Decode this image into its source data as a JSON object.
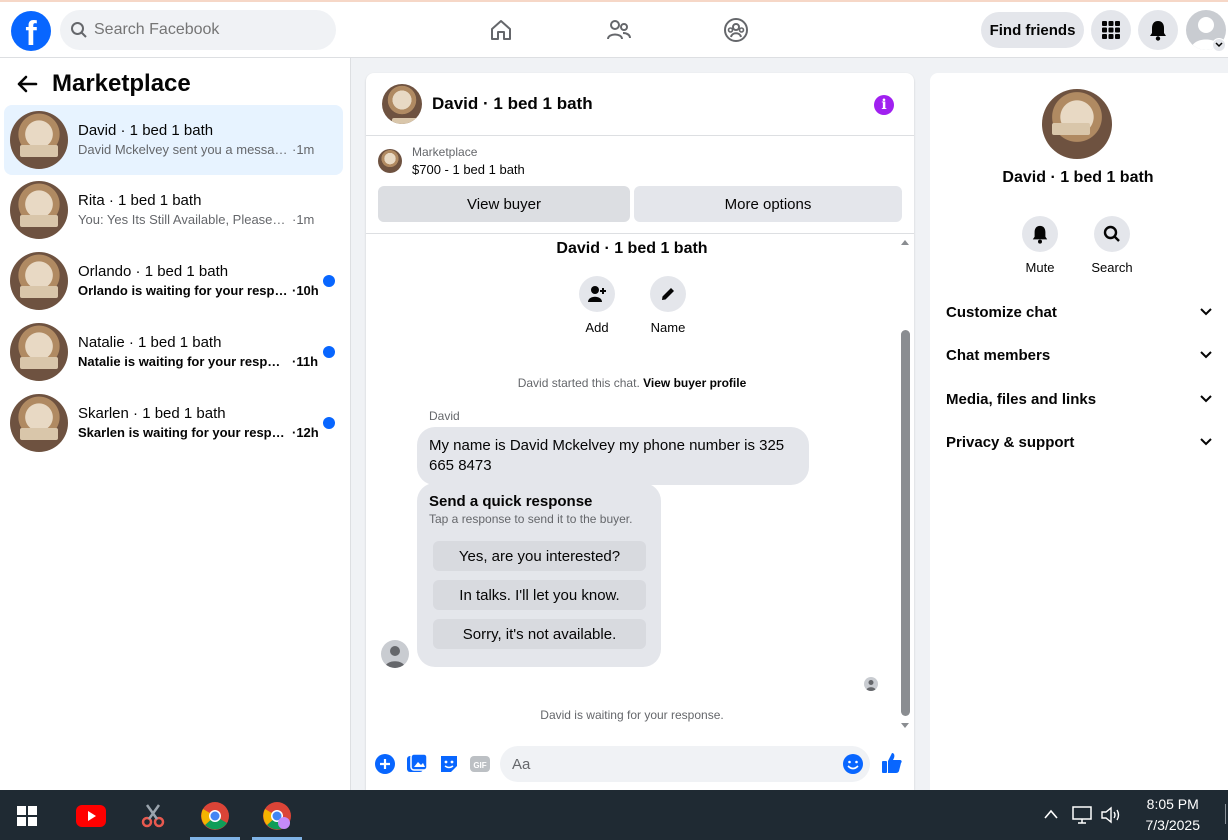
{
  "topbar": {
    "logo_letter": "f",
    "search_placeholder": "Search Facebook",
    "find_friends": "Find friends"
  },
  "left": {
    "title": "Marketplace",
    "conversations": [
      {
        "name": "David · 1 bed 1 bath",
        "message": "David Mckelvey sent you a message ...",
        "time": "·1m",
        "active": true,
        "unread": false
      },
      {
        "name": "Rita · 1 bed 1 bath",
        "message": "You: Yes Its Still Available, Please Sen...",
        "time": "·1m",
        "active": false,
        "unread": false
      },
      {
        "name": "Orlando · 1 bed 1 bath",
        "message": "Orlando is waiting for your respo...",
        "time": "·10h",
        "active": false,
        "unread": true
      },
      {
        "name": "Natalie · 1 bed 1 bath",
        "message": "Natalie is waiting for your respon...",
        "time": "·11h",
        "active": false,
        "unread": true
      },
      {
        "name": "Skarlen · 1 bed 1 bath",
        "message": "Skarlen is waiting for your respo...",
        "time": "·12h",
        "active": false,
        "unread": true
      }
    ]
  },
  "chat": {
    "title": "David · 1 bed 1 bath",
    "info_icon": "i",
    "listing_label": "Marketplace",
    "listing_price": "$700 - 1 bed 1 bath",
    "view_buyer": "View buyer",
    "more_options": "More options",
    "chat_title": "David · 1 bed 1 bath",
    "add_label": "Add",
    "name_label": "Name",
    "started_text": "David started this chat.",
    "view_profile": "View buyer profile",
    "sender": "David",
    "message": "My name is David Mckelvey my phone number is 325 665 8473",
    "quick_title": "Send a quick response",
    "quick_sub": "Tap a response to send it to the buyer.",
    "quick_replies": [
      "Yes, are you interested?",
      "In talks. I'll let you know.",
      "Sorry, it's not available."
    ],
    "waiting": "David is waiting for your response.",
    "composer_placeholder": "Aa"
  },
  "info_panel": {
    "name": "David · 1 bed 1 bath",
    "mute": "Mute",
    "search": "Search",
    "sections": [
      "Customize chat",
      "Chat members",
      "Media, files and links",
      "Privacy & support"
    ]
  },
  "taskbar": {
    "time": "8:05 PM",
    "date": "7/3/2025"
  },
  "colors": {
    "brand": "#0866ff",
    "info": "#a020f0",
    "active_row": "#e7f3ff"
  }
}
